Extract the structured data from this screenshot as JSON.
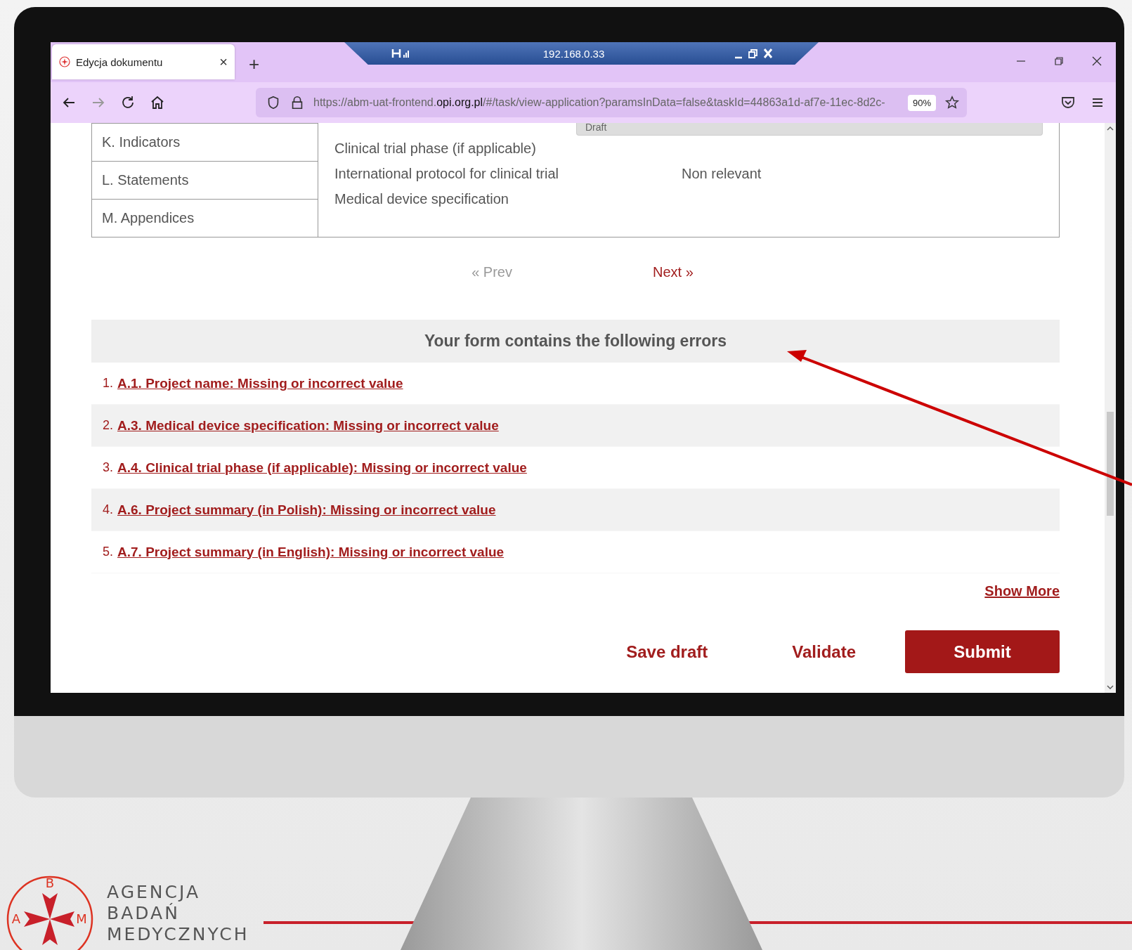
{
  "browser": {
    "tab": {
      "title": "Edycja dokumentu",
      "close": "×"
    },
    "new_tab": "+",
    "remote_bar": {
      "address": "192.168.0.33"
    },
    "nav": [
      {
        "kind": "back",
        "disabled": false
      },
      {
        "kind": "forward",
        "disabled": true
      },
      {
        "kind": "reload",
        "disabled": false
      },
      {
        "kind": "home",
        "disabled": false
      }
    ],
    "url": {
      "prefix": "https://abm-uat-frontend.",
      "domain": "opi.org.pl",
      "path": "/#/task/view-application?paramsInData=false&taskId=44863a1d-af7e-11ec-8d2c-",
      "zoom": "90%"
    }
  },
  "sidebar": {
    "items": [
      {
        "label": "K. Indicators"
      },
      {
        "label": "L. Statements"
      },
      {
        "label": "M. Appendices"
      }
    ]
  },
  "details": {
    "select_value": "Draft",
    "fields": [
      {
        "label": "Clinical trial phase (if applicable)"
      },
      {
        "label": "International protocol for clinical trial",
        "value": "Non relevant"
      },
      {
        "label": "Medical device specification"
      }
    ]
  },
  "pager": {
    "prev_icon": "«",
    "prev": "Prev",
    "prev_disabled": true,
    "next": "Next",
    "next_icon": "»"
  },
  "errors": {
    "title": "Your form contains the following errors",
    "items": [
      {
        "number": "1.",
        "text": "A.1. Project name: Missing or incorrect value"
      },
      {
        "number": "2.",
        "text": "A.3. Medical device specification: Missing or incorrect value"
      },
      {
        "number": "3.",
        "text": "A.4. Clinical trial phase (if applicable): Missing or incorrect value"
      },
      {
        "number": "4.",
        "text": "A.6. Project summary (in Polish): Missing or incorrect value"
      },
      {
        "number": "5.",
        "text": "A.7. Project summary (in English): Missing or incorrect value"
      }
    ],
    "show_more": "Show More"
  },
  "actions": [
    {
      "label": "Save draft",
      "kind": "link"
    },
    {
      "label": "Validate",
      "kind": "link"
    },
    {
      "label": "Submit",
      "kind": "primary"
    }
  ],
  "logo": {
    "letters": [
      "B",
      "A",
      "M"
    ],
    "name": [
      "AGENCJA",
      "BADAŃ",
      "MEDYCZNYCH"
    ]
  }
}
